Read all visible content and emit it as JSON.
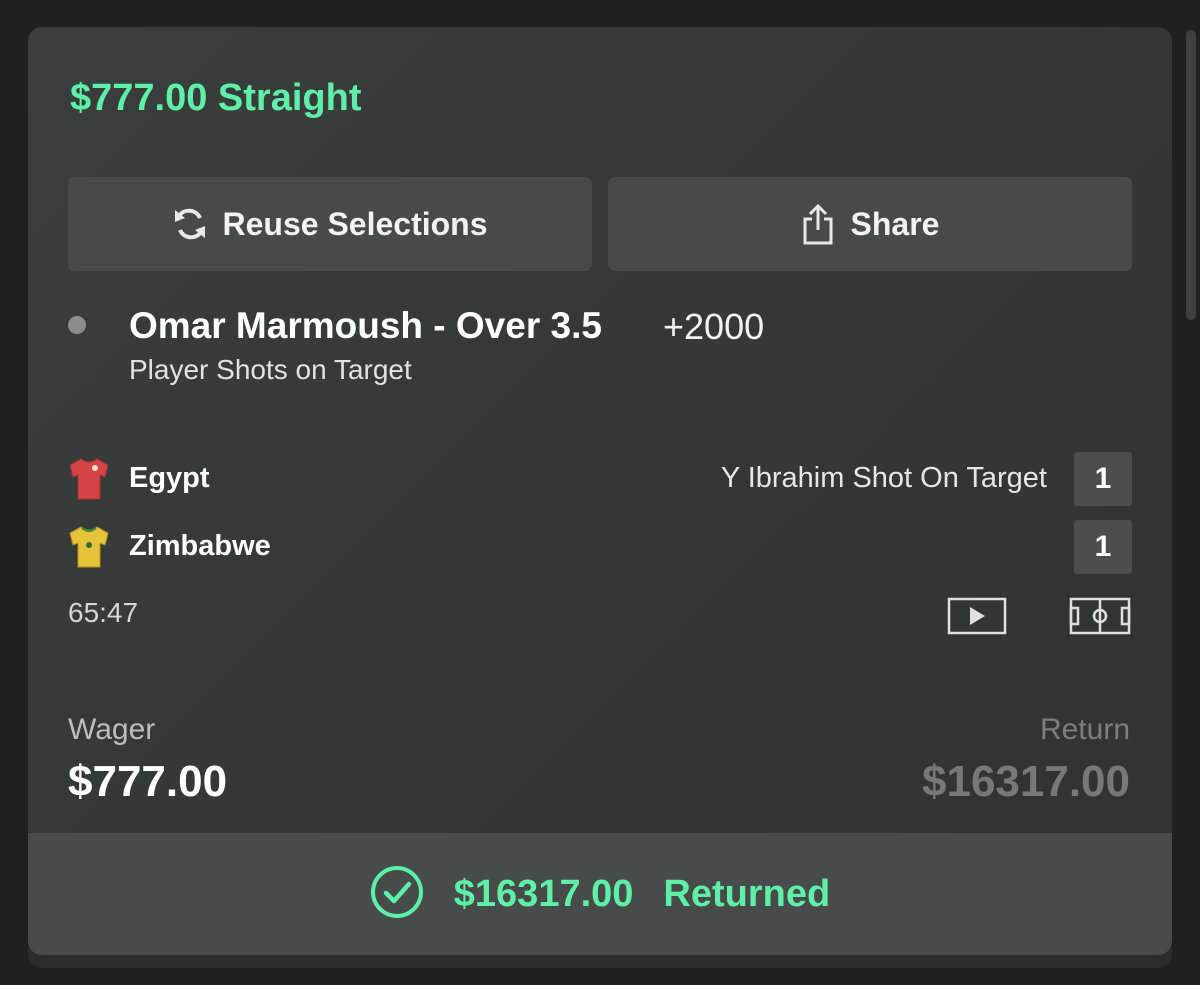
{
  "bet": {
    "title": "$777.00 Straight"
  },
  "actions": {
    "reuse_label": "Reuse Selections",
    "share_label": "Share"
  },
  "selection": {
    "title": "Omar Marmoush - Over 3.5",
    "odds": "+2000",
    "market": "Player Shots on Target"
  },
  "match": {
    "teams": [
      {
        "name": "Egypt",
        "score": "1",
        "icon": "red-jersey-icon"
      },
      {
        "name": "Zimbabwe",
        "score": "1",
        "icon": "yellow-jersey-icon"
      }
    ],
    "event": "Y Ibrahim Shot On Target",
    "clock": "65:47"
  },
  "summary": {
    "wager_label": "Wager",
    "wager_value": "$777.00",
    "return_label": "Return",
    "return_value": "$16317.00"
  },
  "result": {
    "amount": "$16317.00",
    "label": "Returned"
  },
  "colors": {
    "accent": "#5ef0a8",
    "card": "#363a38",
    "footer": "#474b49",
    "egypt_jersey": "#d64545",
    "zimbabwe_jersey": "#e8c23a"
  },
  "icons": [
    "refresh-icon",
    "share-icon",
    "video-icon",
    "pitch-icon",
    "check-circle-icon"
  ]
}
